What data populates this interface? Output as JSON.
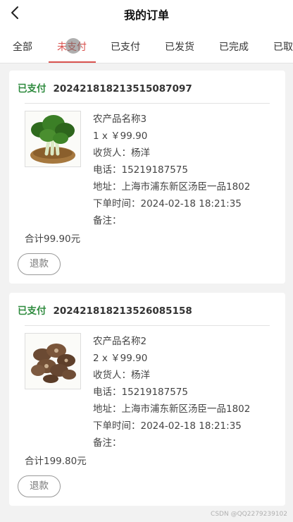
{
  "header": {
    "title": "我的订单"
  },
  "tabs": [
    "全部",
    "未支付",
    "已支付",
    "已发货",
    "已完成",
    "已取"
  ],
  "orders": [
    {
      "status": "已支付",
      "order_no": "20242181821351508709​7",
      "product_name": "农产品名称3",
      "qty_price": "1 x ￥99.90",
      "receiver": "收货人：杨洋",
      "phone": "电话：15219187575",
      "address": "地址：上海市浦东新区汤臣一品1802",
      "order_time": "下单时间：2024-02-18 18:21:35",
      "note": "备注：",
      "total": "合计99.90元",
      "refund_label": "退款"
    },
    {
      "status": "已支付",
      "order_no": "20242181821352608515​8",
      "product_name": "农产品名称2",
      "qty_price": "2 x ￥99.90",
      "receiver": "收货人：杨洋",
      "phone": "电话：15219187575",
      "address": "地址：上海市浦东新区汤臣一品1802",
      "order_time": "下单时间：2024-02-18 18:21:35",
      "note": "备注：",
      "total": "合计199.80元",
      "refund_label": "退款"
    }
  ],
  "watermark": "CSDN @QQ2279239102"
}
